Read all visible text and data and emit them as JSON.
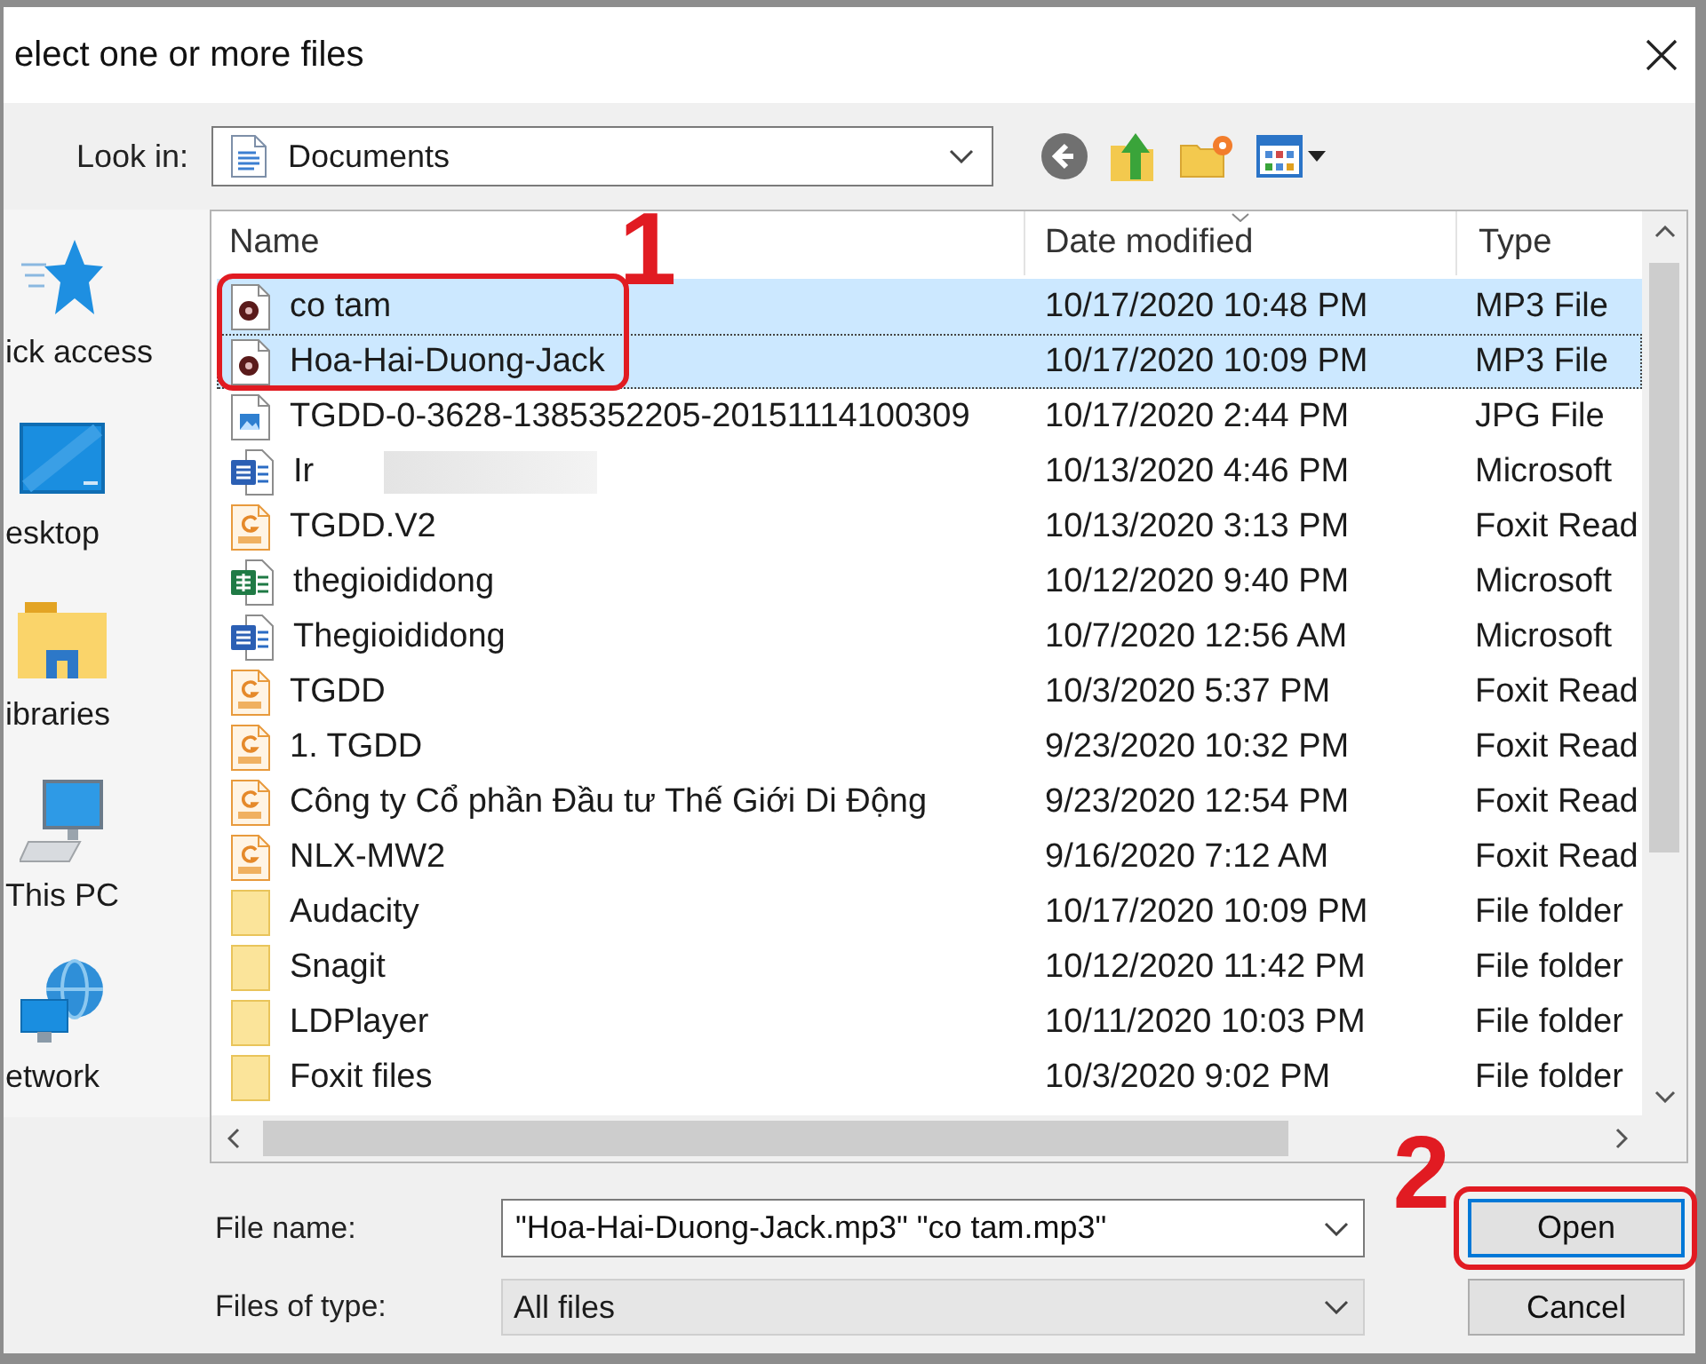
{
  "window": {
    "title": "elect one or more files"
  },
  "look_in": {
    "label": "Look in:",
    "value": "Documents"
  },
  "toolbar": [
    {
      "kind": "back"
    },
    {
      "kind": "up"
    },
    {
      "kind": "new_folder"
    },
    {
      "kind": "view_menu"
    }
  ],
  "sidebar": {
    "items": [
      {
        "kind": "quick_access",
        "label": "ick access"
      },
      {
        "kind": "desktop",
        "label": "esktop"
      },
      {
        "kind": "libraries",
        "label": "ibraries"
      },
      {
        "kind": "this_pc",
        "label": "This PC"
      },
      {
        "kind": "network",
        "label": "etwork"
      }
    ]
  },
  "file_list": {
    "columns": [
      {
        "label": "Name",
        "sorted": false
      },
      {
        "label": "Date modified",
        "sorted": true
      },
      {
        "label": "Type",
        "sorted": false
      }
    ],
    "callout": "1",
    "rows": [
      {
        "kind": "audio",
        "name": "co tam",
        "date": "10/17/2020 10:48 PM",
        "type": "MP3 File",
        "selected": true,
        "focused": false,
        "redacted": false
      },
      {
        "kind": "audio",
        "name": "Hoa-Hai-Duong-Jack",
        "date": "10/17/2020 10:09 PM",
        "type": "MP3 File",
        "selected": true,
        "focused": true,
        "redacted": false
      },
      {
        "kind": "image",
        "name": "TGDD-0-3628-1385352205-20151114100309",
        "date": "10/17/2020 2:44 PM",
        "type": "JPG File",
        "selected": false,
        "focused": false,
        "redacted": false
      },
      {
        "kind": "word",
        "name": "Ir",
        "date": "10/13/2020 4:46 PM",
        "type": "Microsoft",
        "selected": false,
        "focused": false,
        "redacted": true
      },
      {
        "kind": "pdf",
        "name": "TGDD.V2",
        "date": "10/13/2020 3:13 PM",
        "type": "Foxit Read",
        "selected": false,
        "focused": false,
        "redacted": false
      },
      {
        "kind": "excel",
        "name": "thegioididong",
        "date": "10/12/2020 9:40 PM",
        "type": "Microsoft",
        "selected": false,
        "focused": false,
        "redacted": false
      },
      {
        "kind": "word",
        "name": "Thegioididong",
        "date": "10/7/2020 12:56 AM",
        "type": "Microsoft",
        "selected": false,
        "focused": false,
        "redacted": false
      },
      {
        "kind": "pdf",
        "name": "TGDD",
        "date": "10/3/2020 5:37 PM",
        "type": "Foxit Read",
        "selected": false,
        "focused": false,
        "redacted": false
      },
      {
        "kind": "pdf",
        "name": "1. TGDD",
        "date": "9/23/2020 10:32 PM",
        "type": "Foxit Read",
        "selected": false,
        "focused": false,
        "redacted": false
      },
      {
        "kind": "pdf",
        "name": "Công ty Cổ phần Đầu tư Thế Giới Di Động",
        "date": "9/23/2020 12:54 PM",
        "type": "Foxit Read",
        "selected": false,
        "focused": false,
        "redacted": false
      },
      {
        "kind": "pdf",
        "name": "NLX-MW2",
        "date": "9/16/2020 7:12 AM",
        "type": "Foxit Read",
        "selected": false,
        "focused": false,
        "redacted": false
      },
      {
        "kind": "folder",
        "name": "Audacity",
        "date": "10/17/2020 10:09 PM",
        "type": "File folder",
        "selected": false,
        "focused": false,
        "redacted": false
      },
      {
        "kind": "folder",
        "name": "Snagit",
        "date": "10/12/2020 11:42 PM",
        "type": "File folder",
        "selected": false,
        "focused": false,
        "redacted": false
      },
      {
        "kind": "folder",
        "name": "LDPlayer",
        "date": "10/11/2020 10:03 PM",
        "type": "File folder",
        "selected": false,
        "focused": false,
        "redacted": false
      },
      {
        "kind": "folder",
        "name": "Foxit files",
        "date": "10/3/2020 9:02 PM",
        "type": "File folder",
        "selected": false,
        "focused": false,
        "redacted": false
      }
    ]
  },
  "file_name": {
    "label": "File name:",
    "value": "\"Hoa-Hai-Duong-Jack.mp3\" \"co tam.mp3\""
  },
  "file_type": {
    "label": "Files of type:",
    "value": "All files"
  },
  "buttons": [
    {
      "label": "Open",
      "default": true,
      "callout": "2"
    },
    {
      "label": "Cancel",
      "default": false
    }
  ]
}
